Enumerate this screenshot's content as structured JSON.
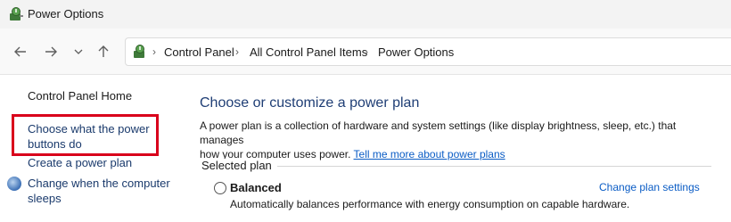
{
  "window": {
    "title": "Power Options",
    "icon": "power-options-icon"
  },
  "navigation": {
    "back_icon": "back-arrow-icon",
    "forward_icon": "forward-arrow-icon",
    "recent_icon": "chevron-down-icon",
    "up_icon": "up-arrow-icon"
  },
  "address": {
    "icon": "control-panel-icon",
    "separator": "›",
    "breadcrumbs": [
      "Control Panel",
      "All Control Panel Items",
      "Power Options"
    ]
  },
  "sidebar": {
    "home": "Control Panel Home",
    "links": [
      {
        "line1": "Choose what the power",
        "line2": "buttons do",
        "highlighted": true
      },
      {
        "line1": "Create a power plan",
        "line2": ""
      },
      {
        "line1": "Change when the computer",
        "line2": "sleeps",
        "icon": "moon-globe-icon"
      }
    ],
    "highlight_color": "#d9001b"
  },
  "main": {
    "heading": "Choose or customize a power plan",
    "description_line1": "A power plan is a collection of hardware and system settings (like display brightness, sleep, etc.) that manages",
    "description_line2": "how your computer uses power. ",
    "learn_more_link": "Tell me more about power plans",
    "group_label": "Selected plan",
    "plan": {
      "name": "Balanced",
      "description": "Automatically balances performance with energy consumption on capable hardware.",
      "change_link": "Change plan settings",
      "selected": false
    }
  },
  "colors": {
    "link": "#0a5cc5",
    "heading": "#1f3e75"
  }
}
